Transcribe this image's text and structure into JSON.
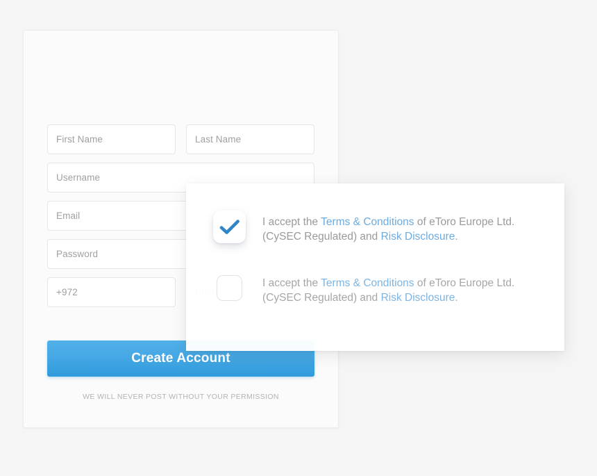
{
  "background_color": "#f5f5f5",
  "signup_card": {
    "fields": {
      "first_name_placeholder": "First Name",
      "last_name_placeholder": "Last Name",
      "username_placeholder": "Username",
      "email_placeholder": "Email",
      "password_placeholder": "Password",
      "phone_prefix_value": "+972",
      "phone_placeholder": "Phone"
    },
    "submit_label": "Create Account",
    "disclaimer": "WE WILL NEVER POST WITHOUT YOUR PERMISSION",
    "accent_color": "#3ba3e0"
  },
  "terms_panel": {
    "rows": [
      {
        "checked": true,
        "text_before": "I accept the ",
        "link1": "Terms & Conditions",
        "text_middle": " of eToro Europe Ltd. (CySEC Regulated) and ",
        "link2": "Risk Disclosure.",
        "checkbox_state_icon": "checkmark-icon"
      },
      {
        "checked": false,
        "text_before": "I accept the ",
        "link1": "Terms & Conditions",
        "text_middle": " of eToro Europe Ltd. (CySEC Regulated) and ",
        "link2": "Risk Disclosure.",
        "checkbox_state_icon": "empty-checkbox-icon"
      }
    ],
    "link_color": "#6cabe0"
  }
}
